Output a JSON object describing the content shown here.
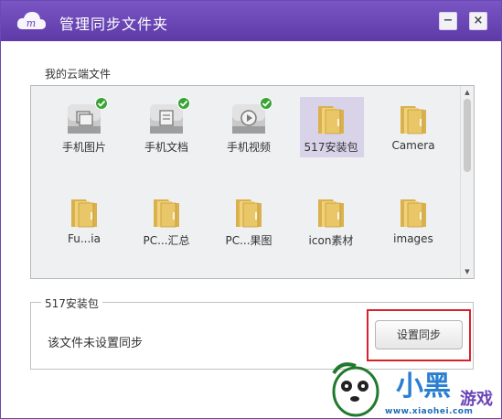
{
  "window": {
    "title": "管理同步文件夹",
    "minimize_label": "−",
    "close_label": "×"
  },
  "cloud_files": {
    "section_label": "我的云端文件",
    "items": [
      {
        "label": "手机图片",
        "icon": "photo-folder-icon",
        "synced": true,
        "selected": false
      },
      {
        "label": "手机文档",
        "icon": "document-folder-icon",
        "synced": true,
        "selected": false
      },
      {
        "label": "手机视频",
        "icon": "video-folder-icon",
        "synced": true,
        "selected": false
      },
      {
        "label": "517安装包",
        "icon": "folder-icon",
        "synced": false,
        "selected": true
      },
      {
        "label": "Camera",
        "icon": "folder-icon",
        "synced": false,
        "selected": false
      },
      {
        "label": "Fu...ia",
        "icon": "folder-icon",
        "synced": false,
        "selected": false
      },
      {
        "label": "PC...汇总",
        "icon": "folder-icon",
        "synced": false,
        "selected": false
      },
      {
        "label": "PC...果图",
        "icon": "folder-icon",
        "synced": false,
        "selected": false
      },
      {
        "label": "icon素材",
        "icon": "folder-icon",
        "synced": false,
        "selected": false
      },
      {
        "label": "images",
        "icon": "folder-icon",
        "synced": false,
        "selected": false
      }
    ]
  },
  "selected_folder": {
    "group_title": "517安装包",
    "status_text": "该文件未设置同步",
    "sync_button_label": "设置同步"
  },
  "watermark": {
    "brand_text": "小黑游戏",
    "site": "www.xiaohei.com"
  },
  "colors": {
    "titlebar": "#6a45b8",
    "folder": "#e9c768",
    "check": "#3aa335",
    "highlight": "#d6232a",
    "selection": "#d9d3ea"
  }
}
